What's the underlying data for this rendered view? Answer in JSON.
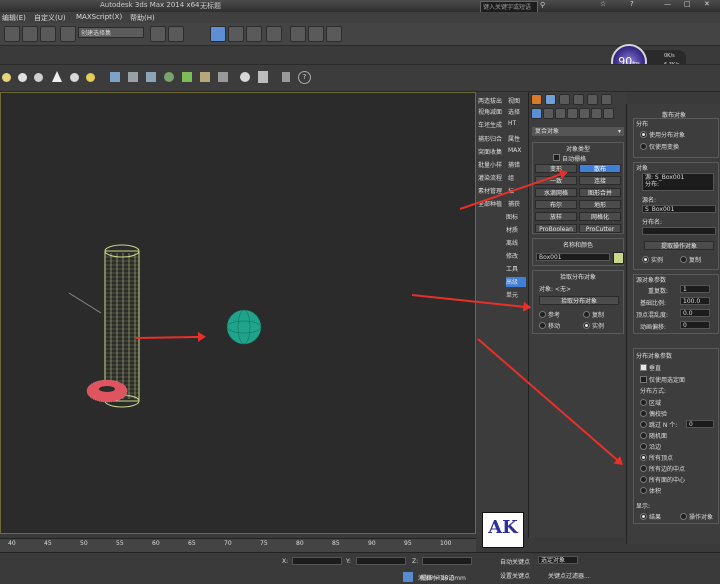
{
  "title_bar": {
    "app_title": "Autodesk 3ds Max 2014 x64",
    "doc_title": "无标题",
    "search_placeholder": "键入关键字或短语"
  },
  "menu": [
    "编辑(E)",
    "自定义(U)",
    "MAXScript(X)",
    "帮助(H)"
  ],
  "toolbar": {
    "selection_filter": "创建选择集"
  },
  "fps": {
    "value": "90",
    "unit": "fps",
    "line1": "0K/s",
    "line2": "6.3K/s"
  },
  "left_menu": [
    "两造拔出",
    "视角减面",
    "车坯生成",
    "捕形归合",
    "突面收集",
    "批量小样",
    "灌染流程",
    "素材管理",
    "全部种植"
  ],
  "left_menu2": [
    "视图",
    "选择",
    "HT",
    "属性",
    "MAX",
    "捕错",
    "组",
    "坛",
    "捕获"
  ],
  "left_menu3": [
    "图标",
    "材质",
    "离线",
    "修改",
    "工具",
    "高级",
    "单元"
  ],
  "create_panel": {
    "category": "复合对象",
    "object_type_title": "对象类型",
    "auto_grid": "自动栅格",
    "buttons": [
      "变形",
      "散布",
      "一致",
      "连接",
      "水滴网格",
      "图形合并",
      "布尔",
      "地形",
      "放样",
      "网格化",
      "ProBoolean",
      "ProCutter"
    ],
    "name_color_title": "名称和颜色",
    "object_name": "Box001",
    "pick_dist_title": "拾取分布对象",
    "pick_object_label": "对象: <无>",
    "pick_dist_button": "拾取分布对象",
    "options": [
      "参考",
      "复制",
      "移动",
      "实例"
    ]
  },
  "right_panel": {
    "top_title": "散布对象",
    "dist_title": "分布",
    "dist_opts": [
      "使用分布对象",
      "仅使用变换"
    ],
    "obj_title": "对象",
    "obj_list": [
      "源: S_Box001",
      "分布:"
    ],
    "name_label": "源名:",
    "name_value": "S_Box001",
    "dist_name_label": "分布名:",
    "extract_btn": "提取操作对象",
    "extract_opts": [
      "实例",
      "复制"
    ],
    "src_params_title": "源对象参数",
    "src_params": [
      {
        "label": "重复数:",
        "value": "1"
      },
      {
        "label": "基础比例:",
        "value": "100.0"
      },
      {
        "label": "顶点混乱度:",
        "value": "0.0"
      },
      {
        "label": "动画偏移:",
        "value": "0"
      }
    ],
    "dist_params_title": "分布对象参数",
    "vertical": "垂直",
    "only_selected": "仅使用选定面",
    "dist_method_label": "分布方式:",
    "dist_methods": [
      "区域",
      "偶校验",
      "跳过 N 个:",
      "随机面",
      "沿边",
      "所有顶点",
      "所有边的中点",
      "所有面的中心",
      "体积"
    ],
    "skip_n": "0",
    "display_label": "显示:",
    "display_opts": [
      "结果",
      "操作对象"
    ]
  },
  "timeline": {
    "ticks": [
      "40",
      "45",
      "50",
      "55",
      "60",
      "65",
      "70",
      "75",
      "80",
      "85",
      "90",
      "95",
      "100"
    ]
  },
  "status": {
    "grid": "栅格 = 10.0mm",
    "auto_key": "自动关键点",
    "set_key": "设置关键点",
    "selected": "选定对象",
    "key_filter": "关键点过滤器...",
    "add_time_tag": "添加时间标记",
    "x": "X:",
    "y": "Y:",
    "z": "Z:"
  },
  "logo": {
    "text": "AK"
  },
  "colors": {
    "accent": "#3f7fd8",
    "arrow": "#e8302a",
    "box_mesh": "#c8d888",
    "sphere": "#1fa38a",
    "torus": "#e05460"
  }
}
